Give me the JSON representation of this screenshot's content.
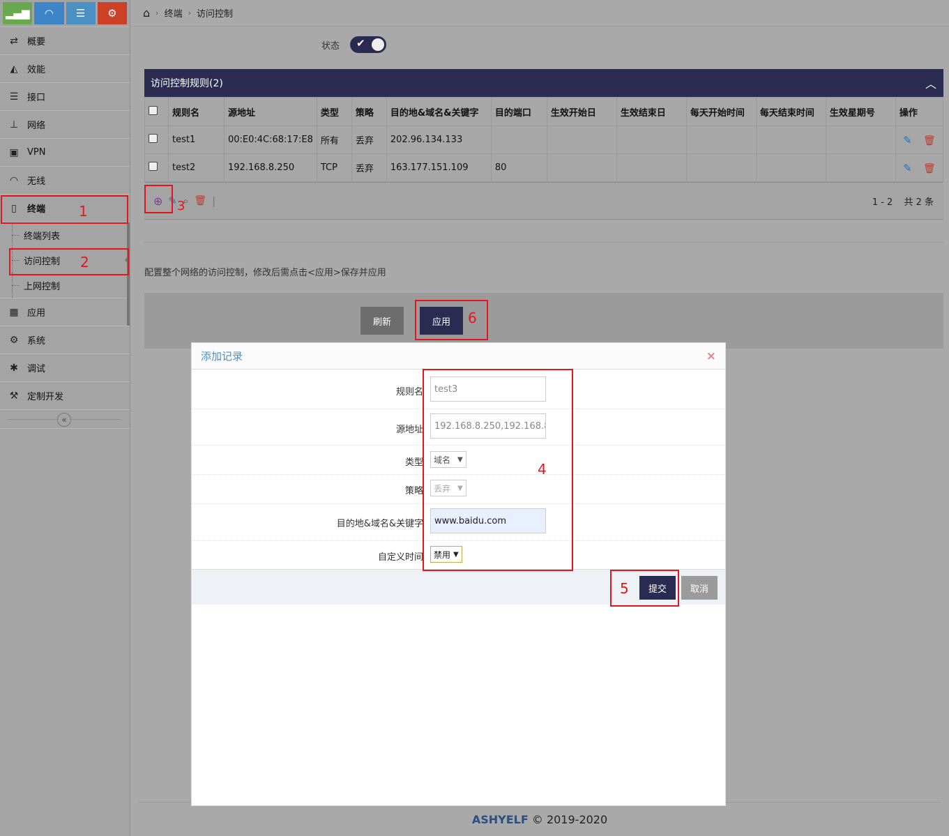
{
  "sidebar": {
    "top_buttons": [
      {
        "icon": "signal-icon",
        "color": "#6aa84f"
      },
      {
        "icon": "wifi-icon",
        "color": "#3d85c6"
      },
      {
        "icon": "list-icon",
        "color": "#4a90c2"
      },
      {
        "icon": "gear-icon",
        "color": "#cc4125"
      }
    ],
    "menu": [
      {
        "label": "概要",
        "icon": "exchange-icon"
      },
      {
        "label": "效能",
        "icon": "area-chart-icon"
      },
      {
        "label": "接口",
        "icon": "list-icon"
      },
      {
        "label": "网络",
        "icon": "sitemap-icon"
      },
      {
        "label": "VPN",
        "icon": "lock-icon"
      },
      {
        "label": "无线",
        "icon": "wifi-icon"
      },
      {
        "label": "终端",
        "icon": "mobile-icon"
      }
    ],
    "submenu": [
      {
        "label": "终端列表"
      },
      {
        "label": "访问控制"
      },
      {
        "label": "上网控制"
      }
    ],
    "menu2": [
      {
        "label": "应用",
        "icon": "building-icon"
      },
      {
        "label": "系统",
        "icon": "cogs-icon"
      },
      {
        "label": "调试",
        "icon": "bug-icon"
      },
      {
        "label": "定制开发",
        "icon": "gavel-icon"
      }
    ]
  },
  "breadcrumb": {
    "home_icon": "home-icon",
    "items": [
      "终端",
      "访问控制"
    ]
  },
  "status": {
    "label": "状态",
    "enabled": true
  },
  "rules": {
    "title": "访问控制规则(2)",
    "columns": [
      "规则名",
      "源地址",
      "类型",
      "策略",
      "目的地&域名&关键字",
      "目的端口",
      "生效开始日",
      "生效结束日",
      "每天开始时间",
      "每天结束时间",
      "生效星期号",
      "操作"
    ],
    "rows": [
      {
        "name": "test1",
        "src": "00:E0:4C:68:17:E8",
        "type": "所有",
        "policy": "丢弃",
        "dest": "202.96.134.133",
        "port": "",
        "start_date": "",
        "end_date": "",
        "day_start": "",
        "day_end": "",
        "weekday": ""
      },
      {
        "name": "test2",
        "src": "192.168.8.250",
        "type": "TCP",
        "policy": "丢弃",
        "dest": "163.177.151.109",
        "port": "80",
        "start_date": "",
        "end_date": "",
        "day_start": "",
        "day_end": "",
        "weekday": ""
      }
    ],
    "pager": {
      "range": "1 - 2",
      "total": "共 2 条"
    }
  },
  "hint": "配置整个网络的访问控制，修改后需点击<应用>保存并应用",
  "buttons": {
    "refresh": "刷新",
    "apply": "应用"
  },
  "footer": {
    "brand": "ASHYELF",
    "copyright": "© 2019-2020"
  },
  "modal": {
    "title": "添加记录",
    "fields": {
      "name": {
        "label": "规则名",
        "value": "test3"
      },
      "src": {
        "label": "源地址",
        "value": "192.168.8.250,192.168.8"
      },
      "type": {
        "label": "类型",
        "value": "域名"
      },
      "policy": {
        "label": "策略",
        "value": "丢弃"
      },
      "dest": {
        "label": "目的地&域名&关键字",
        "value": "www.baidu.com"
      },
      "custom_time": {
        "label": "自定义时间",
        "value": "禁用"
      }
    },
    "submit": "提交",
    "cancel": "取消"
  },
  "annotations": [
    "1",
    "2",
    "3",
    "4",
    "5",
    "6"
  ],
  "colors": {
    "primary": "#2b2b52",
    "annotation": "#e8141b",
    "dest_input_bg": "#e8f0fe"
  }
}
